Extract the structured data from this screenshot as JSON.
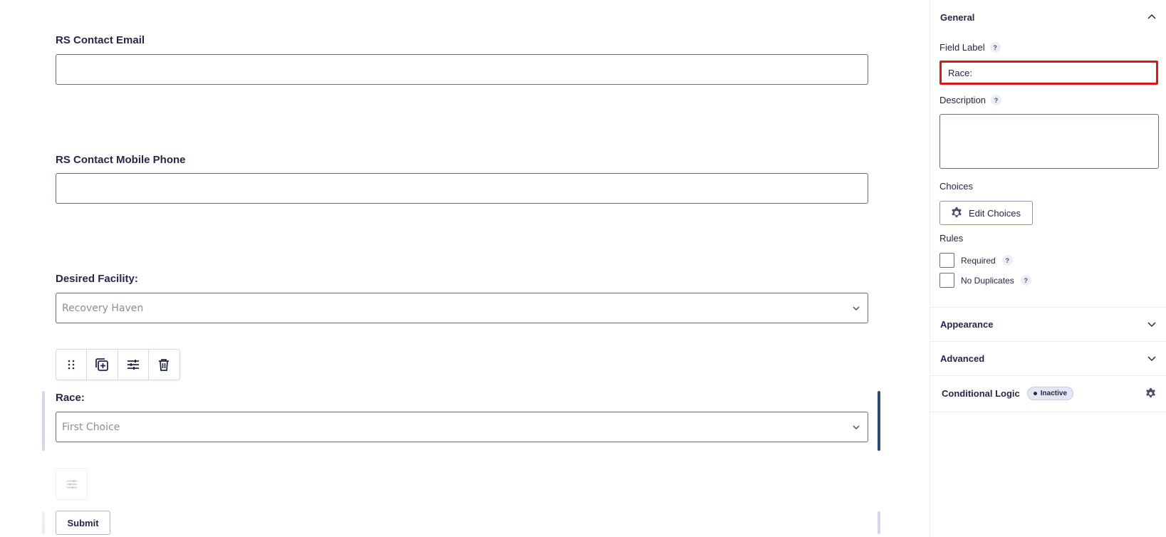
{
  "form": {
    "fields": [
      {
        "label": "RS Contact Email",
        "type": "text",
        "value": ""
      },
      {
        "label": "RS Contact Mobile Phone",
        "type": "text",
        "value": ""
      },
      {
        "label": "Desired Facility:",
        "type": "select",
        "value": "Recovery Haven"
      },
      {
        "label": "Race:",
        "type": "select",
        "value": "First Choice"
      }
    ],
    "toolbar": {
      "icons": [
        "drag-handle-icon",
        "duplicate-icon",
        "settings-sliders-icon",
        "trash-icon"
      ]
    },
    "submit_label": "Submit"
  },
  "sidebar": {
    "general": {
      "title": "General",
      "field_label_title": "Field Label",
      "field_label_value": "Race:",
      "description_title": "Description",
      "description_value": "",
      "choices_title": "Choices",
      "edit_choices_label": "Edit Choices",
      "rules_title": "Rules",
      "rules": [
        {
          "label": "Required",
          "checked": false
        },
        {
          "label": "No Duplicates",
          "checked": false
        }
      ]
    },
    "appearance_title": "Appearance",
    "advanced_title": "Advanced",
    "conditional_logic": {
      "title": "Conditional Logic",
      "status": "Inactive"
    },
    "help_glyph": "?"
  },
  "colors": {
    "accent_dark": "#242748",
    "highlight_red": "#e0141c",
    "selected_bar": "#2f4c6e"
  }
}
